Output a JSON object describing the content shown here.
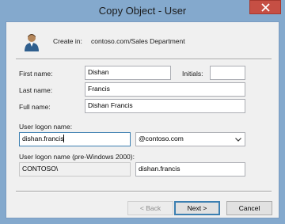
{
  "window": {
    "title": "Copy Object - User"
  },
  "header": {
    "create_in_label": "Create in:",
    "create_in_value": "contoso.com/Sales Department",
    "user_icon": "user-icon"
  },
  "form": {
    "first_name_label": "First name:",
    "first_name_value": "Dishan",
    "initials_label": "Initials:",
    "initials_value": "",
    "last_name_label": "Last name:",
    "last_name_value": "Francis",
    "full_name_label": "Full name:",
    "full_name_value": "Dishan Francis",
    "logon_label": "User logon name:",
    "logon_value": "dishan.francis",
    "domain_value": "@contoso.com",
    "pre2000_label": "User logon name (pre-Windows 2000):",
    "pre2000_domain_value": "CONTOSO\\",
    "pre2000_user_value": "dishan.francis"
  },
  "buttons": {
    "back_label": "< Back",
    "next_label": "Next >",
    "cancel_label": "Cancel"
  },
  "colors": {
    "title_bar": "#84a9cd",
    "close_button": "#c64f44",
    "dialog_bg": "#f0f0f0"
  }
}
